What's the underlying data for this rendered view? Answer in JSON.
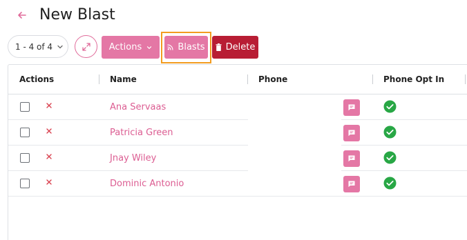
{
  "page": {
    "title": "New Blast",
    "back_icon": "arrow-left-icon"
  },
  "toolbar": {
    "pager_label": "1 - 4 of 4",
    "expand_icon": "expand-arrows-icon",
    "actions_label": "Actions",
    "blasts_label": "Blasts",
    "blasts_icon": "rss-icon",
    "delete_label": "Delete",
    "delete_icon": "trash-icon"
  },
  "table": {
    "columns": [
      "Actions",
      "Name",
      "Phone",
      "Phone Opt In"
    ],
    "rows": [
      {
        "name": "Ana Servaas",
        "phone": "",
        "phone_opt_in": true
      },
      {
        "name": "Patricia Green",
        "phone": "",
        "phone_opt_in": true
      },
      {
        "name": "Jnay Wiley",
        "phone": "",
        "phone_opt_in": true
      },
      {
        "name": "Dominic Antonio",
        "phone": "",
        "phone_opt_in": true
      }
    ]
  },
  "colors": {
    "accent": "#e477a5",
    "name_link": "#dc5d92",
    "delete": "#b81d34",
    "highlight": "#f39c1f",
    "opt_in_check": "#28a745",
    "remove_x": "#d9414f"
  }
}
